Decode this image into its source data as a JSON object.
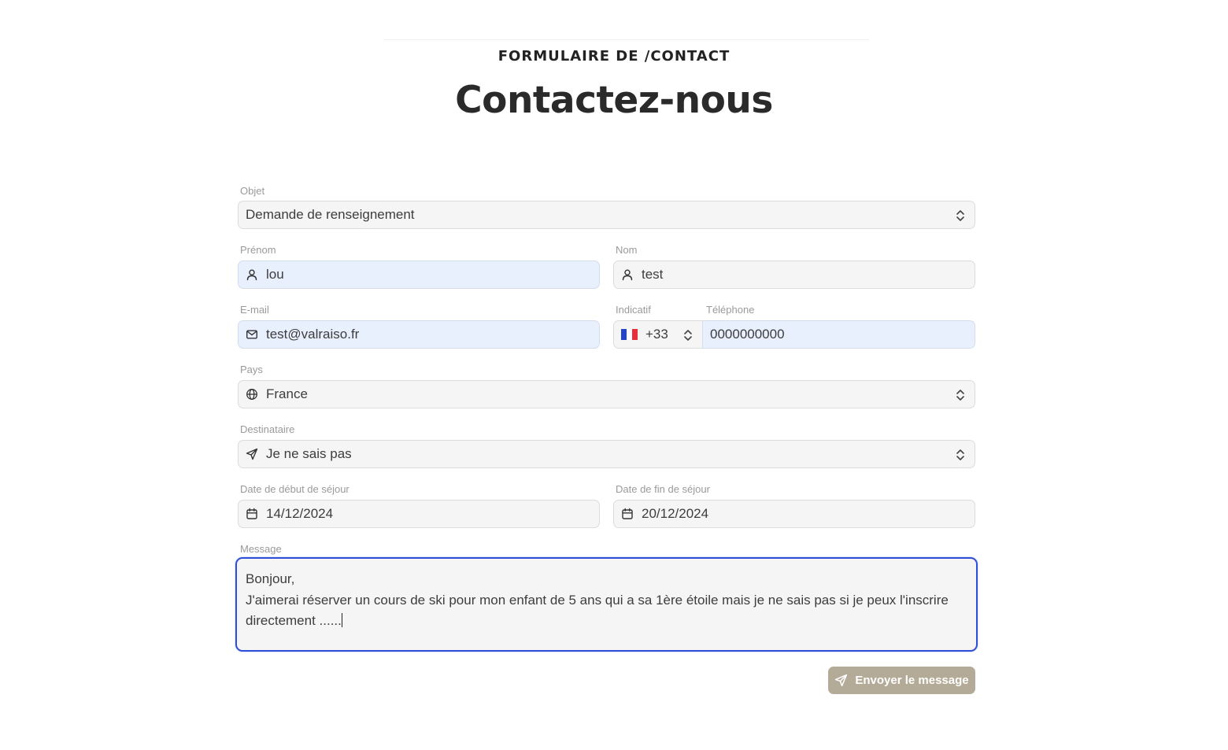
{
  "header": {
    "eyebrow": "FORMULAIRE DE /CONTACT",
    "title": "Contactez-nous"
  },
  "form": {
    "objet": {
      "label": "Objet",
      "value": "Demande de renseignement"
    },
    "prenom": {
      "label": "Prénom",
      "value": "lou",
      "icon": "user-icon"
    },
    "nom": {
      "label": "Nom",
      "value": "test",
      "icon": "user-icon"
    },
    "email": {
      "label": "E-mail",
      "value": "test@valraiso.fr",
      "icon": "mail-icon"
    },
    "indicatif": {
      "label": "Indicatif",
      "value": "+33",
      "icon": "france-flag-icon"
    },
    "telephone": {
      "label": "Téléphone",
      "value": "0000000000"
    },
    "pays": {
      "label": "Pays",
      "value": "France",
      "icon": "globe-icon"
    },
    "destinataire": {
      "label": "Destinataire",
      "value": "Je ne sais pas",
      "icon": "send-icon"
    },
    "date_debut": {
      "label": "Date de début de séjour",
      "value": "14/12/2024",
      "icon": "calendar-icon"
    },
    "date_fin": {
      "label": "Date de fin de séjour",
      "value": "20/12/2024",
      "icon": "calendar-icon"
    },
    "message": {
      "label": "Message",
      "value": "Bonjour,\nJ'aimerai réserver un cours de ski pour mon enfant de 5 ans qui a sa 1ère étoile mais je ne sais pas si je peux l'inscrire directement ......"
    },
    "submit_label": "Envoyer le message"
  },
  "colors": {
    "accent_button": "#b3aa97",
    "focus_border": "#2f4fd8",
    "autofill_bg": "#e8f0fe"
  }
}
